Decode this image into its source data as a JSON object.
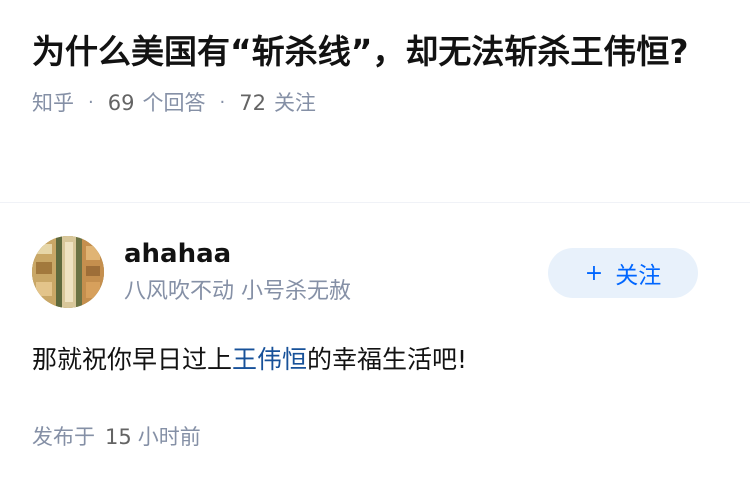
{
  "question": {
    "title": "为什么美国有“斩杀线”，却无法斩杀王伟恒?",
    "source": "知乎",
    "answer_count": "69",
    "answer_label": "个回答",
    "follow_count": "72",
    "follow_label": "关注"
  },
  "author": {
    "name": "ahahaa",
    "bio": "八风吹不动 小号杀无赦",
    "follow_button_plus": "+",
    "follow_button_label": "关注"
  },
  "answer": {
    "text_before": "那就祝你早日过上",
    "link_text": "王伟恒",
    "text_after": "的幸福生活吧!",
    "time_prefix": "发布于",
    "time_number": "15",
    "time_suffix": "小时前"
  },
  "colors": {
    "accent": "#0066ff",
    "link": "#175199",
    "muted": "#8590a6",
    "button_bg": "#e8f1fb"
  }
}
